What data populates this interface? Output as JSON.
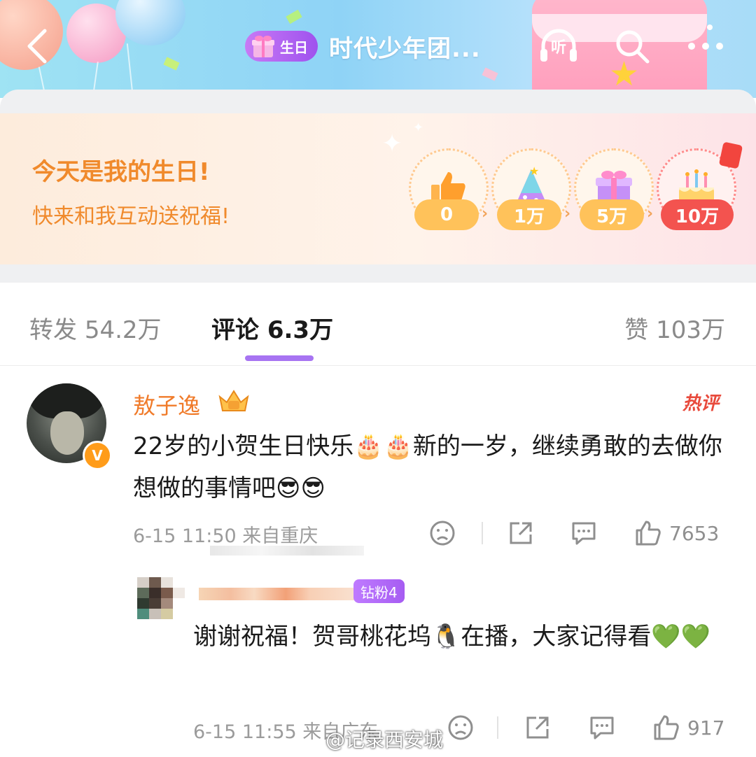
{
  "header": {
    "badge_label": "生日",
    "title": "时代少年团...",
    "listen_label": "听"
  },
  "birthday_card": {
    "title": "今天是我的生日!",
    "subtitle": "快来和我互动送祝福!",
    "milestones": [
      {
        "value": "0",
        "icon": "thumbs-up-icon"
      },
      {
        "value": "1万",
        "icon": "party-hat-icon"
      },
      {
        "value": "5万",
        "icon": "gift-box-icon"
      },
      {
        "value": "10万",
        "icon": "birthday-cake-icon"
      }
    ]
  },
  "tabs": {
    "repost_label": "转发",
    "repost_count": "54.2万",
    "comment_label": "评论",
    "comment_count": "6.3万",
    "like_label": "赞",
    "like_count": "103万"
  },
  "comment": {
    "username": "敖子逸",
    "tag": "热评",
    "verified_badge": "V",
    "text": "22岁的小贺生日快乐🎂🎂新的一岁，继续勇敢的去做你想做的事情吧😎😎",
    "meta": "6-15 11:50  来自重庆",
    "like_count": "7653"
  },
  "reply": {
    "fan_badge": "钻粉4",
    "text": "谢谢祝福！贺哥桃花坞🐧在播，大家记得看💚💚",
    "meta": "6-15 11:55  来自广东",
    "like_count": "917"
  },
  "watermark": "@记录西安城",
  "colors": {
    "accent_orange": "#f07b2a",
    "tab_indicator": "#a774f2",
    "hot_red": "#e84a3c"
  }
}
